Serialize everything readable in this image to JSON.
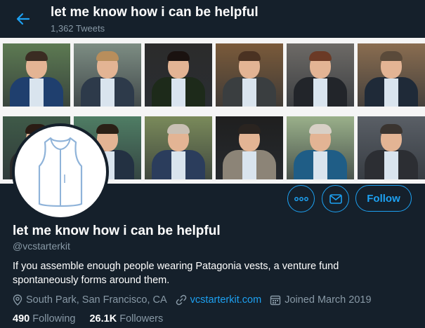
{
  "header": {
    "title": "let me know how i can be helpful",
    "tweet_count": "1,362 Tweets"
  },
  "banner": {
    "photos": [
      {
        "name": "banner-photo-1",
        "bg": "#5d7a52",
        "torso": "#1f3f6e",
        "hair": "#3a2c22"
      },
      {
        "name": "banner-photo-2",
        "bg": "#7d8d83",
        "torso": "#2d3a4a",
        "hair": "#b88e5c"
      },
      {
        "name": "banner-photo-3",
        "bg": "#2b2b2b",
        "torso": "#1d2a1a",
        "hair": "#1a1210"
      },
      {
        "name": "banner-photo-4",
        "bg": "#7a5a3a",
        "torso": "#3a3e40",
        "hair": "#4a3222"
      },
      {
        "name": "banner-photo-5",
        "bg": "#6d6a66",
        "torso": "#22252a",
        "hair": "#6b3a26"
      },
      {
        "name": "banner-photo-6",
        "bg": "#8a6d50",
        "torso": "#1f2a38",
        "hair": "#5a4a3a"
      },
      {
        "name": "banner-photo-7",
        "bg": "#3f5a48",
        "torso": "#2a2a2a",
        "hair": "#2a1c14"
      },
      {
        "name": "banner-photo-8",
        "bg": "#4f7d64",
        "torso": "#233142",
        "hair": "#2a2016"
      },
      {
        "name": "banner-photo-9",
        "bg": "#7a8a5a",
        "torso": "#2b3d5c",
        "hair": "#c9c0b4"
      },
      {
        "name": "banner-photo-10",
        "bg": "#1f1f1f",
        "torso": "#8c8477",
        "hair": "#2a2420"
      },
      {
        "name": "banner-photo-11",
        "bg": "#9ab08a",
        "torso": "#1f5d86",
        "hair": "#d8d0c6"
      },
      {
        "name": "banner-photo-12",
        "bg": "#5a5f66",
        "torso": "#2c2e33",
        "hair": "#3a3430"
      }
    ]
  },
  "actions": {
    "more_icon": "more-icon",
    "message_icon": "envelope-icon",
    "follow_label": "Follow"
  },
  "profile": {
    "name": "let me know how i can be helpful",
    "handle": "@vcstarterkit",
    "bio": "If you assemble enough people wearing Patagonia vests, a venture fund spontaneously forms around them.",
    "location": "South Park, San Francisco, CA",
    "website": "vcstarterkit.com",
    "joined": "Joined March 2019",
    "following_count": "490",
    "following_label": "Following",
    "followers_count": "26.1K",
    "followers_label": "Followers"
  },
  "colors": {
    "background": "#15202b",
    "accent": "#1da1f2",
    "secondary_text": "#8899a6"
  }
}
